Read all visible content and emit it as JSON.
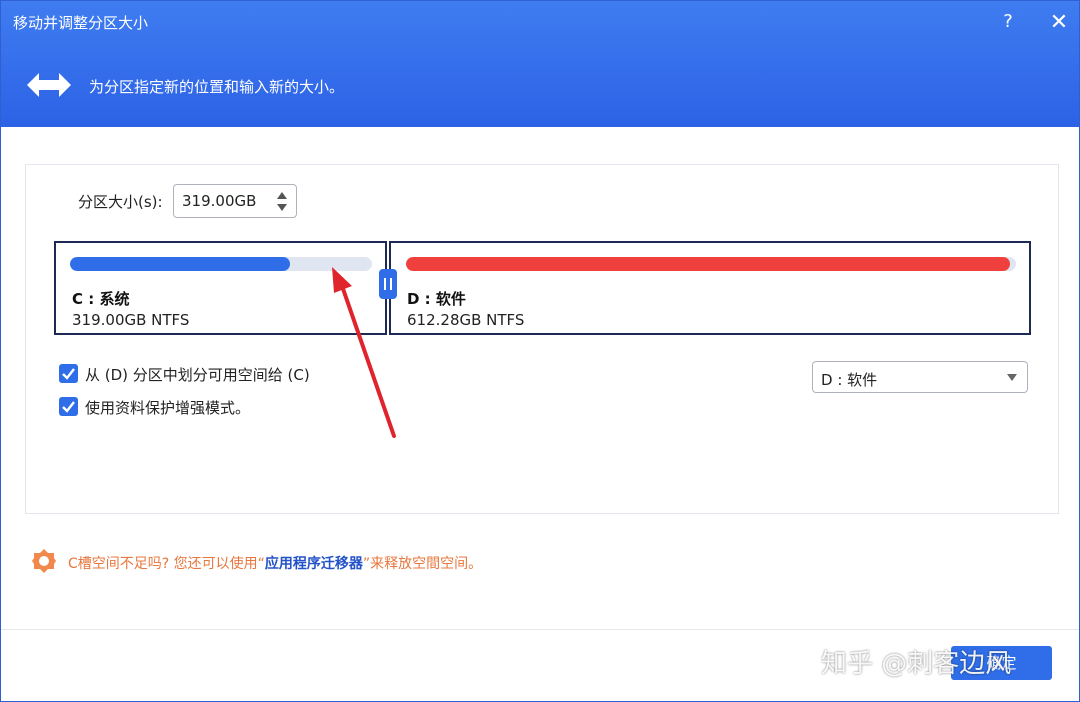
{
  "window": {
    "title": "移动并调整分区大小",
    "help_label": "?",
    "close_label": "✕",
    "subtitle": "为分区指定新的位置和输入新的大小。",
    "header_icon": "resize-arrows-icon"
  },
  "size": {
    "label": "分区大小(s):",
    "value": "319.00GB"
  },
  "partitions": [
    {
      "name": "C : 系统",
      "info": "319.00GB NTFS",
      "usage_fraction": 0.73,
      "bar_color": "#2f6ee8",
      "selected": true
    },
    {
      "name": "D : 软件",
      "info": "612.28GB NTFS",
      "usage_fraction": 0.99,
      "bar_color": "#f0403e",
      "selected": true
    }
  ],
  "options": {
    "allocate": {
      "label": "从 (D) 分区中划分可用空间给 (C)",
      "checked": true
    },
    "protect": {
      "label": "使用资料保护增强模式。",
      "checked": true
    },
    "source_select": {
      "value": "D : 软件"
    }
  },
  "tip": {
    "icon": "warning-badge-icon",
    "prefix": "C槽空间不足吗? 您还可以使用“",
    "link": "应用程序迁移器",
    "suffix": "”来释放空間空间。"
  },
  "footer": {
    "ok_label": "确定"
  },
  "watermark": "知乎 @刺客边风",
  "colors": {
    "header": "#2c62e6",
    "accent": "#2f6ee8",
    "partition_border": "#1c2a55",
    "used_c": "#2f6ee8",
    "used_d": "#f0403e",
    "tip_text": "#e8773e",
    "tip_link": "#2453c8",
    "annotation_arrow": "#e0242c"
  }
}
